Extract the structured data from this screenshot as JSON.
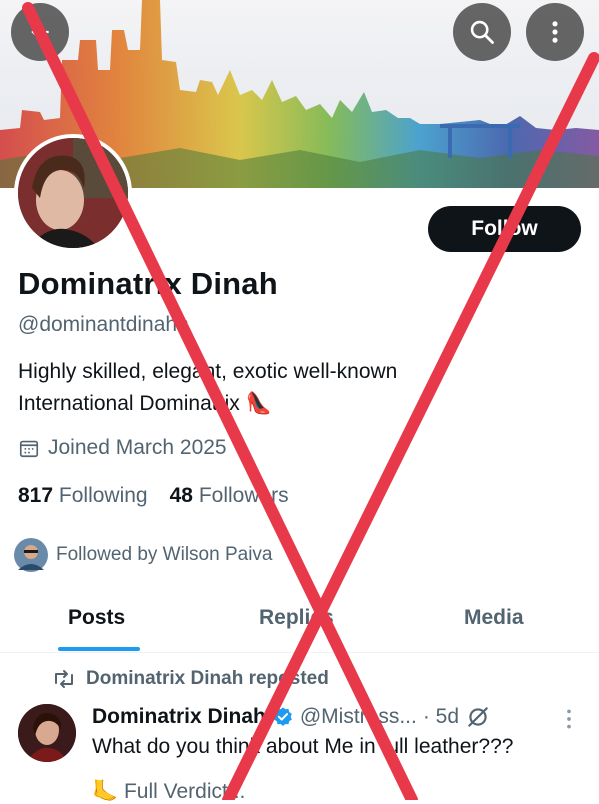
{
  "header": {
    "back_icon": "back-arrow-icon",
    "search_icon": "search-icon",
    "more_icon": "more-vertical-icon"
  },
  "profile": {
    "display_name": "Dominatrix Dinah",
    "handle": "@dominantdinahh",
    "follow_label": "Follow",
    "bio_line1": "Highly skilled, elegant, exotic well-known",
    "bio_line2": "International Dominatrix",
    "bio_emoji": "👠",
    "joined": "Joined March 2025",
    "following_count": "817",
    "following_label": "Following",
    "followers_count": "48",
    "followers_label": "Followers",
    "followed_by": "Followed by Wilson Paiva"
  },
  "tabs": [
    {
      "label": "Posts",
      "active": true
    },
    {
      "label": "Replies",
      "active": false
    },
    {
      "label": "Media",
      "active": false
    }
  ],
  "post": {
    "repost_label": "Dominatrix Dinah reposted",
    "author": "Dominatrix Dinah",
    "handle": "@Mistress...",
    "time": "· 5d",
    "text": "What do you think about Me in full leather???",
    "text2": "🦶 Full Verdict..."
  },
  "colors": {
    "accent": "#1d9bf0",
    "overlay_cross": "#e8394a",
    "follow_bg": "#0f1419"
  }
}
